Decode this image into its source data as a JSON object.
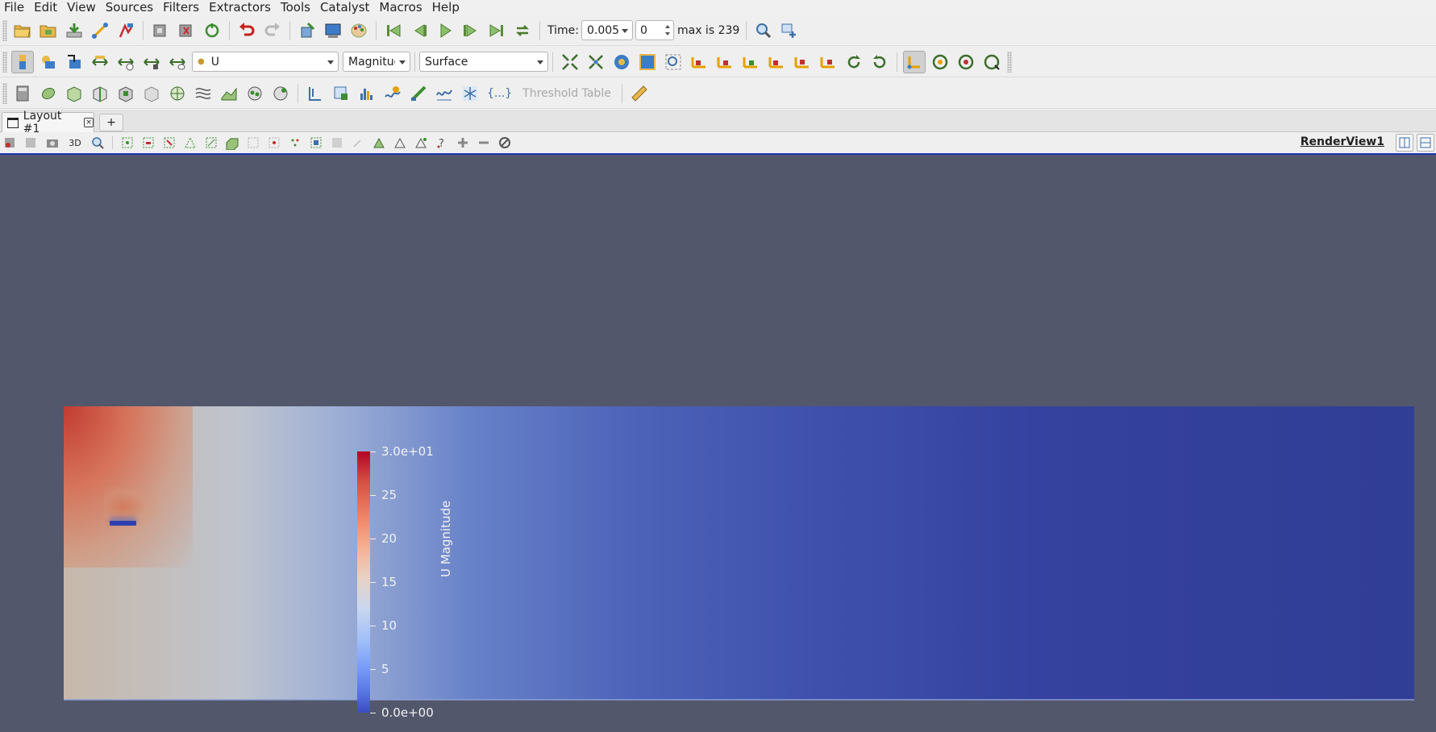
{
  "menu": [
    "File",
    "Edit",
    "View",
    "Sources",
    "Filters",
    "Extractors",
    "Tools",
    "Catalyst",
    "Macros",
    "Help"
  ],
  "toolbar_time": {
    "time_label": "Time:",
    "time_value": "0.005",
    "timestep_value": "0",
    "max_label": "max is 239"
  },
  "toolbar_display": {
    "array_name": "U",
    "component": "Magnitude",
    "representation": "Surface"
  },
  "toolbar_filters": {
    "threshold_table_label": "Threshold Table",
    "python_label": "{...}"
  },
  "tabs": {
    "layout_label": "Layout #1",
    "add_label": "+"
  },
  "view": {
    "render_view_name": "RenderView1",
    "mode_3d_label": "3D"
  },
  "colorbar": {
    "title": "U Magnitude",
    "range": [
      0,
      30
    ],
    "tick_labels": [
      "3.0e+01",
      "25",
      "20",
      "15",
      "10",
      "5",
      "0.0e+00"
    ],
    "colormap": "Cool to Warm"
  },
  "colors": {
    "background": "#52576b",
    "accent_border": "#2034b8"
  }
}
